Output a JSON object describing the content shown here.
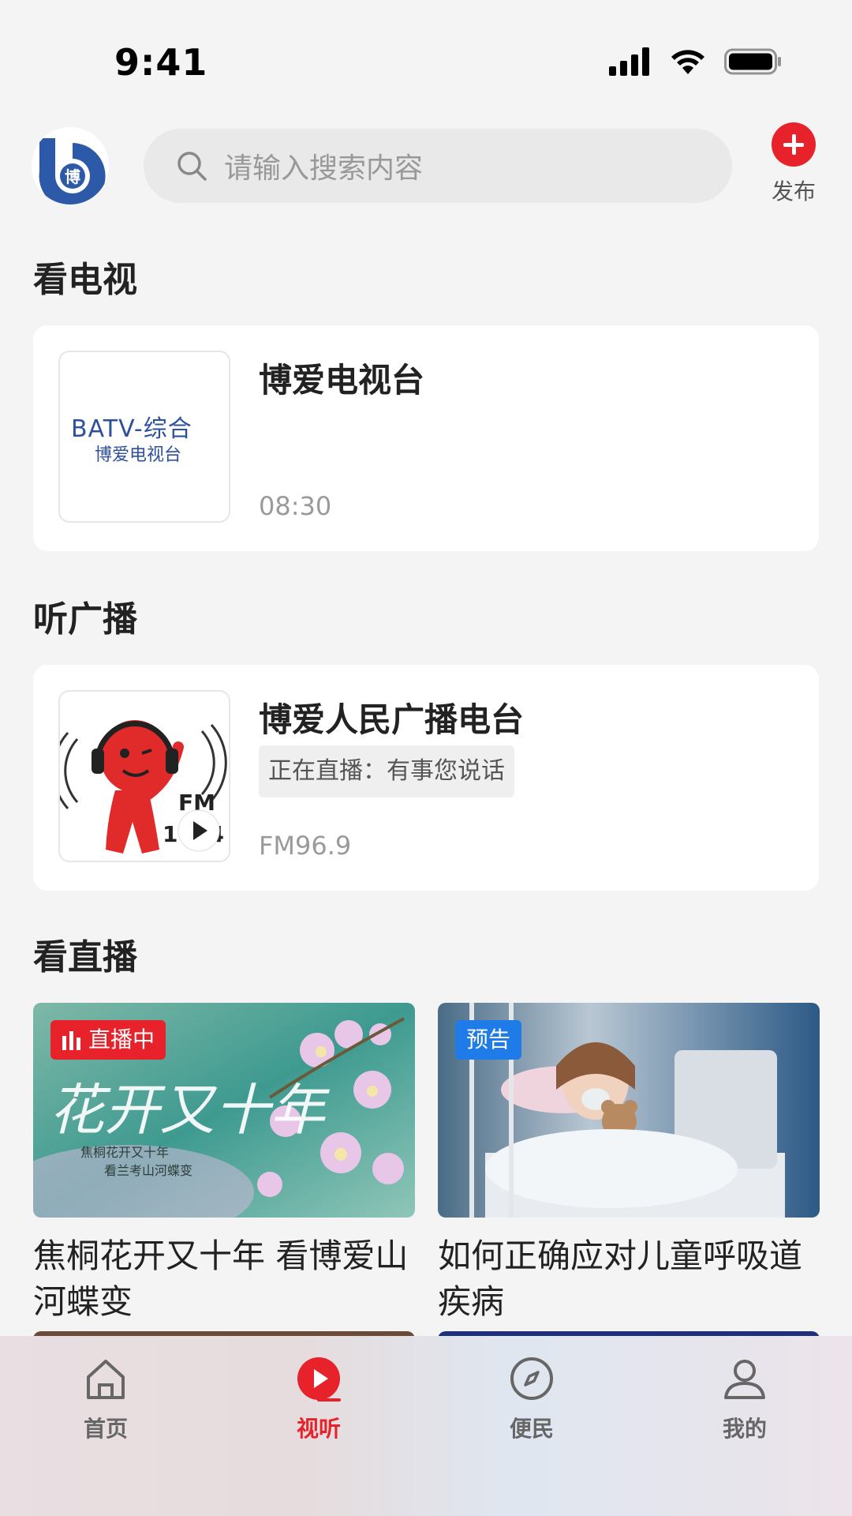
{
  "status_bar": {
    "time": "9:41"
  },
  "header": {
    "logo_text": "博",
    "search_placeholder": "请输入搜索内容",
    "publish_label": "发布"
  },
  "tv": {
    "section_title": "看电视",
    "channel_name": "博爱电视台",
    "time": "08:30",
    "thumb_line1": "BATV-综合",
    "thumb_line2": "博爱电视台"
  },
  "radio": {
    "section_title": "听广播",
    "station_name": "博爱人民广播电台",
    "now_playing": "正在直播：有事您说话",
    "frequency": "FM96.9",
    "thumb_fm": "FM",
    "thumb_num": "1064"
  },
  "live": {
    "section_title": "看直播",
    "items": [
      {
        "badge": "直播中",
        "title": "焦桐花开又十年 看博爱山河蝶变",
        "img_text1": "花开又十年",
        "img_text2": "焦桐花开又十年",
        "img_text3": "看兰考山河蝶变"
      },
      {
        "badge": "预告",
        "title": "如何正确应对儿童呼吸道疾病"
      }
    ]
  },
  "tabbar": {
    "tabs": [
      {
        "label": "首页",
        "icon": "home-icon"
      },
      {
        "label": "视听",
        "icon": "play-icon",
        "active": true
      },
      {
        "label": "便民",
        "icon": "compass-icon"
      },
      {
        "label": "我的",
        "icon": "user-icon"
      }
    ]
  },
  "colors": {
    "accent": "#e8222a",
    "preview_badge": "#1e7be8"
  }
}
